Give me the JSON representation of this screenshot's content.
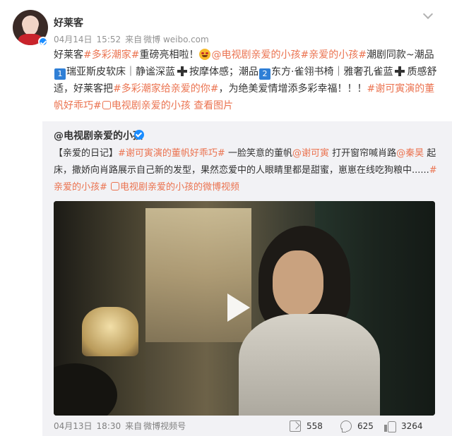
{
  "post": {
    "username": "好莱客",
    "date": "04月14日",
    "time": "15:52",
    "source_prefix": "来自",
    "source": "微博 weibo.com",
    "text": {
      "p1": "好莱客",
      "tag_colorful": "#多彩潮家#",
      "p2": "重磅亮相啦！",
      "tag_drama": "@电视剧亲爱的小孩",
      "tag_child": "#亲爱的小孩#",
      "p3": "潮剧同款~潮品",
      "badge1": "1",
      "p4": "瑞亚斯皮软床｜静谧深蓝",
      "p5": "按摩体感；潮品",
      "badge2": "2",
      "p6": "东方·雀翎书椅｜雅奢孔雀蓝",
      "p7": "质感舒适，好莱客把",
      "tag_give": "#多彩潮家给亲爱的你#",
      "p8": "，为绝美爱情增添多彩幸福！！！",
      "tag_xie": "#谢可寅演的董帆好乖巧#",
      "tag_drama2": "电视剧亲爱的小孩",
      "view_images": "查看图片"
    }
  },
  "repost": {
    "author": "@电视剧亲爱的小孩",
    "text": {
      "p1": "【亲爱的日记】",
      "tag_xie": "#谢可寅演的董帆好乖巧#",
      "p2": " 一脸笑意的董帆",
      "mention_xie": "@谢可寅",
      "p3": " 打开窗帘喊肖路",
      "mention_qin": "@秦昊",
      "p4": " 起床，撒娇向肖路展示自己新的发型，果然恋爱中的人眼睛里都是甜蜜，崽崽在线吃狗粮中......",
      "tag_child": "#亲爱的小孩#",
      "video_link": "电视剧亲爱的小孩的微博视频"
    },
    "date": "04月13日",
    "time": "18:30",
    "source_prefix": "来自",
    "source": "微博视频号"
  },
  "actions": {
    "forward_count": "558",
    "comment_count": "625",
    "like_count": "3264"
  },
  "icons": {
    "chevron": "chevron-down-icon",
    "play": "play-icon",
    "forward": "forward-icon",
    "comment": "comment-icon",
    "like": "like-icon"
  },
  "colors": {
    "link": "#eb7350",
    "repost_bg": "#f2f2f5",
    "verified": "#1a8cff"
  }
}
